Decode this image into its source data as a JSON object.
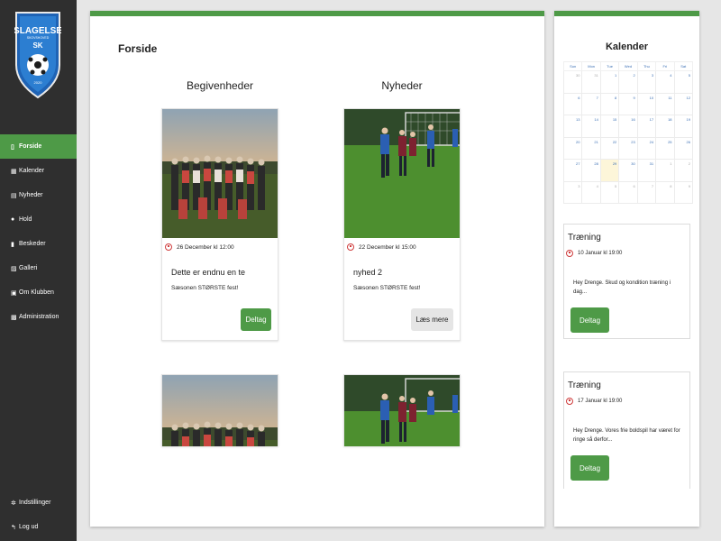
{
  "logo": {
    "name": "SLAGELSE",
    "abbr": "SK",
    "small_text": "SKOVSHOVED",
    "year": "2020"
  },
  "sidebar": {
    "items": [
      {
        "label": "Forside",
        "icon": "file-icon",
        "active": true
      },
      {
        "label": "Kalender",
        "icon": "calendar-icon",
        "active": false
      },
      {
        "label": "Nyheder",
        "icon": "newspaper-icon",
        "active": false
      },
      {
        "label": "Hold",
        "icon": "users-icon",
        "active": false
      },
      {
        "label": "Beskeder",
        "icon": "message-icon",
        "active": false
      },
      {
        "label": "Galleri",
        "icon": "images-icon",
        "active": false
      },
      {
        "label": "Om Klubben",
        "icon": "info-icon",
        "active": false
      },
      {
        "label": "Administration",
        "icon": "admin-icon",
        "active": false
      }
    ],
    "bottom": [
      {
        "label": "Indstillinger",
        "icon": "gear-icon"
      },
      {
        "label": "Log ud",
        "icon": "logout-icon"
      }
    ]
  },
  "main": {
    "title": "Forside",
    "events_heading": "Begivenheder",
    "news_heading": "Nyheder",
    "event_cards": [
      {
        "date": "26 December kl 12:00",
        "title": "Dette er endnu en te",
        "text": "Sæsonen STØRSTE fest!",
        "button": "Deltag"
      }
    ],
    "news_cards": [
      {
        "date": "22 December kl 15:00",
        "title": "nyhed 2",
        "text": "Sæsonen STØRSTE fest!",
        "button": "Læs mere"
      }
    ]
  },
  "calendar": {
    "title": "Kalender",
    "weekdays": [
      "Sun",
      "Mon",
      "Tue",
      "Wed",
      "Thu",
      "Fri",
      "Sat"
    ],
    "weeks": [
      [
        "30",
        "31",
        "1",
        "2",
        "3",
        "4",
        "5"
      ],
      [
        "6",
        "7",
        "8",
        "9",
        "10",
        "11",
        "12"
      ],
      [
        "13",
        "14",
        "15",
        "16",
        "17",
        "18",
        "19"
      ],
      [
        "20",
        "21",
        "22",
        "23",
        "24",
        "25",
        "26"
      ],
      [
        "27",
        "28",
        "29",
        "30",
        "31",
        "1",
        "2"
      ],
      [
        "3",
        "4",
        "5",
        "6",
        "7",
        "8",
        "9"
      ]
    ],
    "events": [
      {
        "title": "Træning",
        "date": "10 Januar kl 19:00",
        "text": "Hey Drenge. Skud og kondition træning i dag...",
        "button": "Deltag"
      },
      {
        "title": "Træning",
        "date": "17 Januar kl 19:00",
        "text": "Hey Drenge. Vores frie boldspil har været for ringe så derfor...",
        "button": "Deltag"
      }
    ]
  },
  "colors": {
    "accent": "#4e9a47",
    "sidebar": "#2f2f2f",
    "clock": "#cf3c3c",
    "calendar_text": "#3a6fb4"
  }
}
